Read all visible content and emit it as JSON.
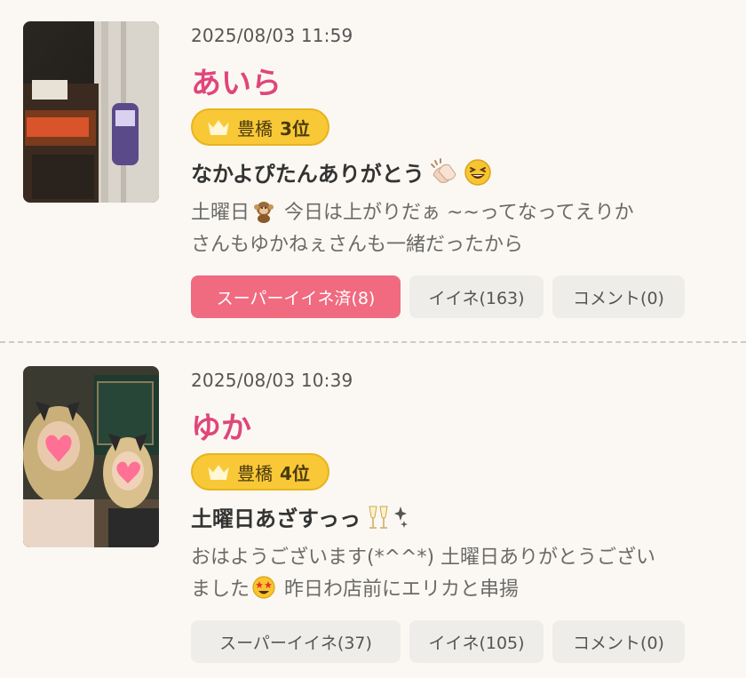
{
  "posts": [
    {
      "timestamp": "2025/08/03 11:59",
      "name": "あいら",
      "rank": {
        "area": "豊橋",
        "position": "3位"
      },
      "headline": "なかよぴたんありがとう",
      "headline_emojis": [
        "clapping-hands-icon",
        "grinning-squinting-face-icon"
      ],
      "body_lines": [
        "土曜日",
        " 今日は上がりだぁ ~~ってなってえりか",
        "さんもゆかねぇさんも一緒だったから"
      ],
      "body_emoji": "monkey-icon",
      "actions": {
        "super_like": "スーパーイイネ済(8)",
        "super_like_active": true,
        "like": "イイネ(163)",
        "comment": "コメント(0)"
      }
    },
    {
      "timestamp": "2025/08/03 10:39",
      "name": "ゆか",
      "rank": {
        "area": "豊橋",
        "position": "4位"
      },
      "headline": "土曜日あざすっっ",
      "headline_emojis": [
        "champagne-glasses-icon",
        "sparkle-icon"
      ],
      "body_lines": [
        "おはようございます(*^^*) 土曜日ありがとうござい",
        "ました",
        " 昨日わ店前にエリカと串揚"
      ],
      "body_emoji": "star-struck-face-icon",
      "actions": {
        "super_like": "スーパーイイネ(37)",
        "super_like_active": false,
        "like": "イイネ(105)",
        "comment": "コメント(0)"
      }
    }
  ],
  "colors": {
    "background": "#fbf8f3",
    "name": "#e0457b",
    "badge": "#f8c837",
    "super_like_active": "#f06a80",
    "button": "#efedea"
  }
}
